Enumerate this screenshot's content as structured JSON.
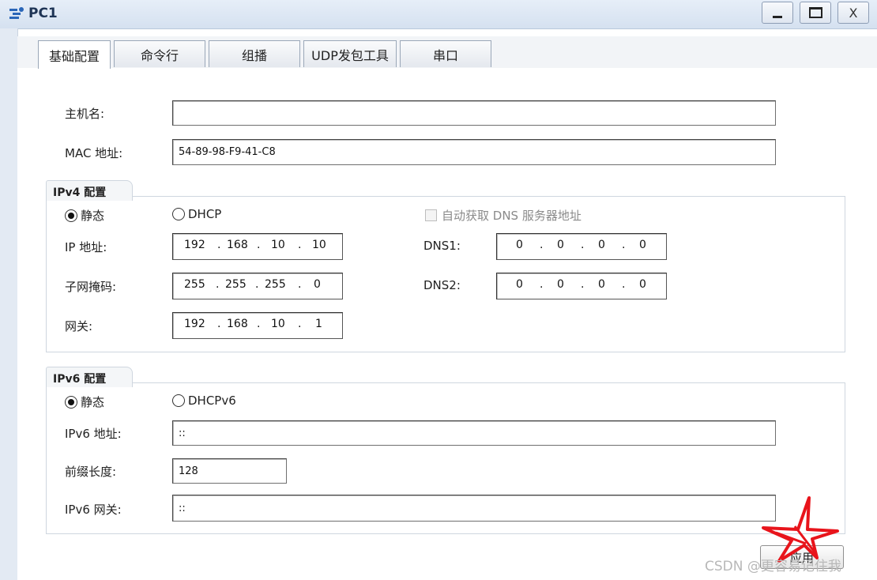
{
  "window": {
    "title": "PC1",
    "minimize": "_",
    "maximize": "□",
    "close": "X"
  },
  "tabs": [
    {
      "label": "基础配置"
    },
    {
      "label": "命令行"
    },
    {
      "label": "组播"
    },
    {
      "label": "UDP发包工具"
    },
    {
      "label": "串口"
    }
  ],
  "basic": {
    "hostname_label": "主机名:",
    "hostname_value": "",
    "mac_label": "MAC 地址:",
    "mac_value": "54-89-98-F9-41-C8"
  },
  "ipv4": {
    "group_title": "IPv4 配置",
    "mode_static": "静态",
    "mode_dhcp": "DHCP",
    "auto_dns_label": "自动获取 DNS 服务器地址",
    "ip_label": "IP 地址:",
    "ip": [
      "192",
      "168",
      "10",
      "10"
    ],
    "mask_label": "子网掩码:",
    "mask": [
      "255",
      "255",
      "255",
      "0"
    ],
    "gateway_label": "网关:",
    "gateway": [
      "192",
      "168",
      "10",
      "1"
    ],
    "dns1_label": "DNS1:",
    "dns1": [
      "0",
      "0",
      "0",
      "0"
    ],
    "dns2_label": "DNS2:",
    "dns2": [
      "0",
      "0",
      "0",
      "0"
    ]
  },
  "ipv6": {
    "group_title": "IPv6 配置",
    "mode_static": "静态",
    "mode_dhcp": "DHCPv6",
    "addr_label": "IPv6 地址:",
    "addr_value": "::",
    "prefix_label": "前缀长度:",
    "prefix_value": "128",
    "gateway_label": "IPv6 网关:",
    "gateway_value": "::"
  },
  "apply_label": "应用",
  "watermark": "CSDN @更容易记住我",
  "colors": {
    "titlebar": "#d5e1f0",
    "annotation": "#e8141b"
  }
}
